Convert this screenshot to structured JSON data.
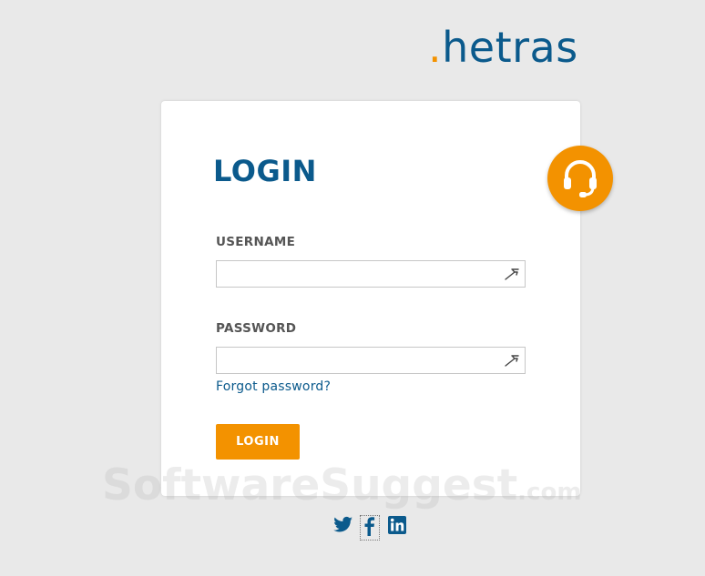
{
  "brand": {
    "logo_dot": ".",
    "logo_text": "hetras"
  },
  "login": {
    "title": "LOGIN",
    "username_label": "USERNAME",
    "username_value": "",
    "password_label": "PASSWORD",
    "password_value": "",
    "forgot_link": "Forgot password?",
    "submit_label": "LOGIN"
  },
  "support": {
    "icon": "headset-icon"
  },
  "social": {
    "icons": [
      "twitter-icon",
      "facebook-icon",
      "linkedin-icon"
    ]
  },
  "watermark": {
    "text": "SoftwareSuggest",
    "tld": ".com"
  },
  "colors": {
    "brand_blue": "#0b5a8c",
    "accent_orange": "#f39200",
    "background": "#e9e9e9"
  }
}
